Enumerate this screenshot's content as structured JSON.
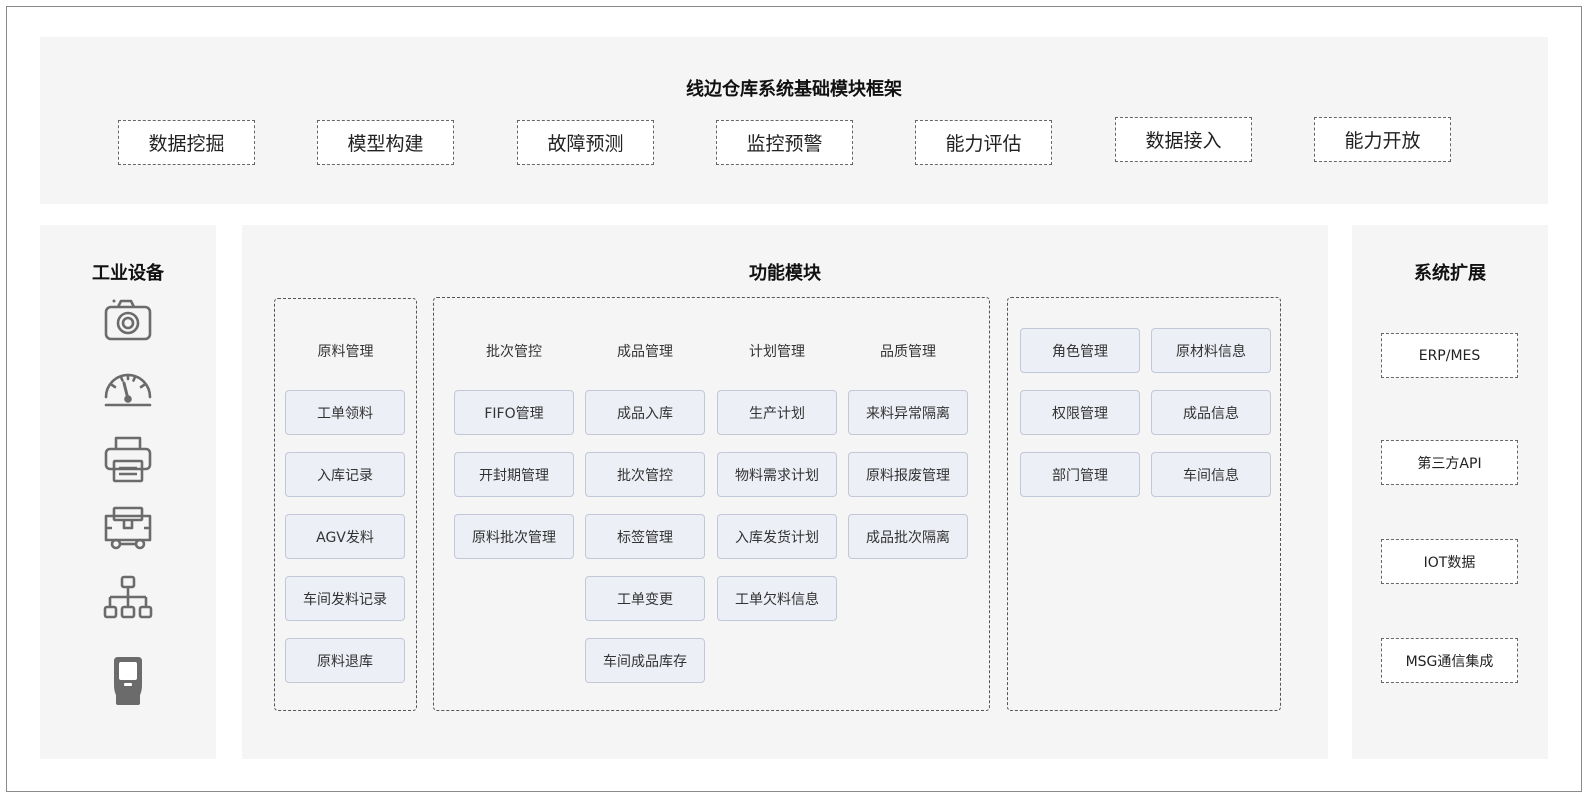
{
  "top": {
    "title": "线边仓库系统基础模块框架",
    "items": [
      "数据挖掘",
      "模型构建",
      "故障预测",
      "监控预警",
      "能力评估",
      "数据接入",
      "能力开放"
    ]
  },
  "left": {
    "title": "工业设备",
    "icons": [
      "camera-icon",
      "gauge-icon",
      "printer-icon",
      "agv-vehicle-icon",
      "network-topology-icon",
      "handheld-scanner-icon"
    ]
  },
  "center": {
    "title": "功能模块",
    "material": {
      "header": "原料管理",
      "items": [
        "工单领料",
        "入库记录",
        "AGV发料",
        "车间发料记录",
        "原料退库"
      ]
    },
    "columns": [
      {
        "header": "批次管控",
        "items": [
          "FIFO管理",
          "开封期管理",
          "原料批次管理"
        ]
      },
      {
        "header": "成品管理",
        "items": [
          "成品入库",
          "批次管控",
          "标签管理",
          "工单变更",
          "车间成品库存"
        ]
      },
      {
        "header": "计划管理",
        "items": [
          "生产计划",
          "物料需求计划",
          "入库发货计划",
          "工单欠料信息"
        ]
      },
      {
        "header": "品质管理",
        "items": [
          "来料异常隔离",
          "原料报废管理",
          "成品批次隔离"
        ]
      }
    ],
    "admin": {
      "left": [
        "角色管理",
        "权限管理",
        "部门管理"
      ],
      "right": [
        "原材料信息",
        "成品信息",
        "车间信息"
      ]
    }
  },
  "right": {
    "title": "系统扩展",
    "items": [
      "ERP/MES",
      "第三方API",
      "IOT数据",
      "MSG通信集成"
    ]
  },
  "colors": {
    "panel_bg": "#f5f5f5",
    "button_bg": "#edeff6",
    "button_border": "#c3c8d8",
    "icon_gray": "#6b6b6b"
  }
}
